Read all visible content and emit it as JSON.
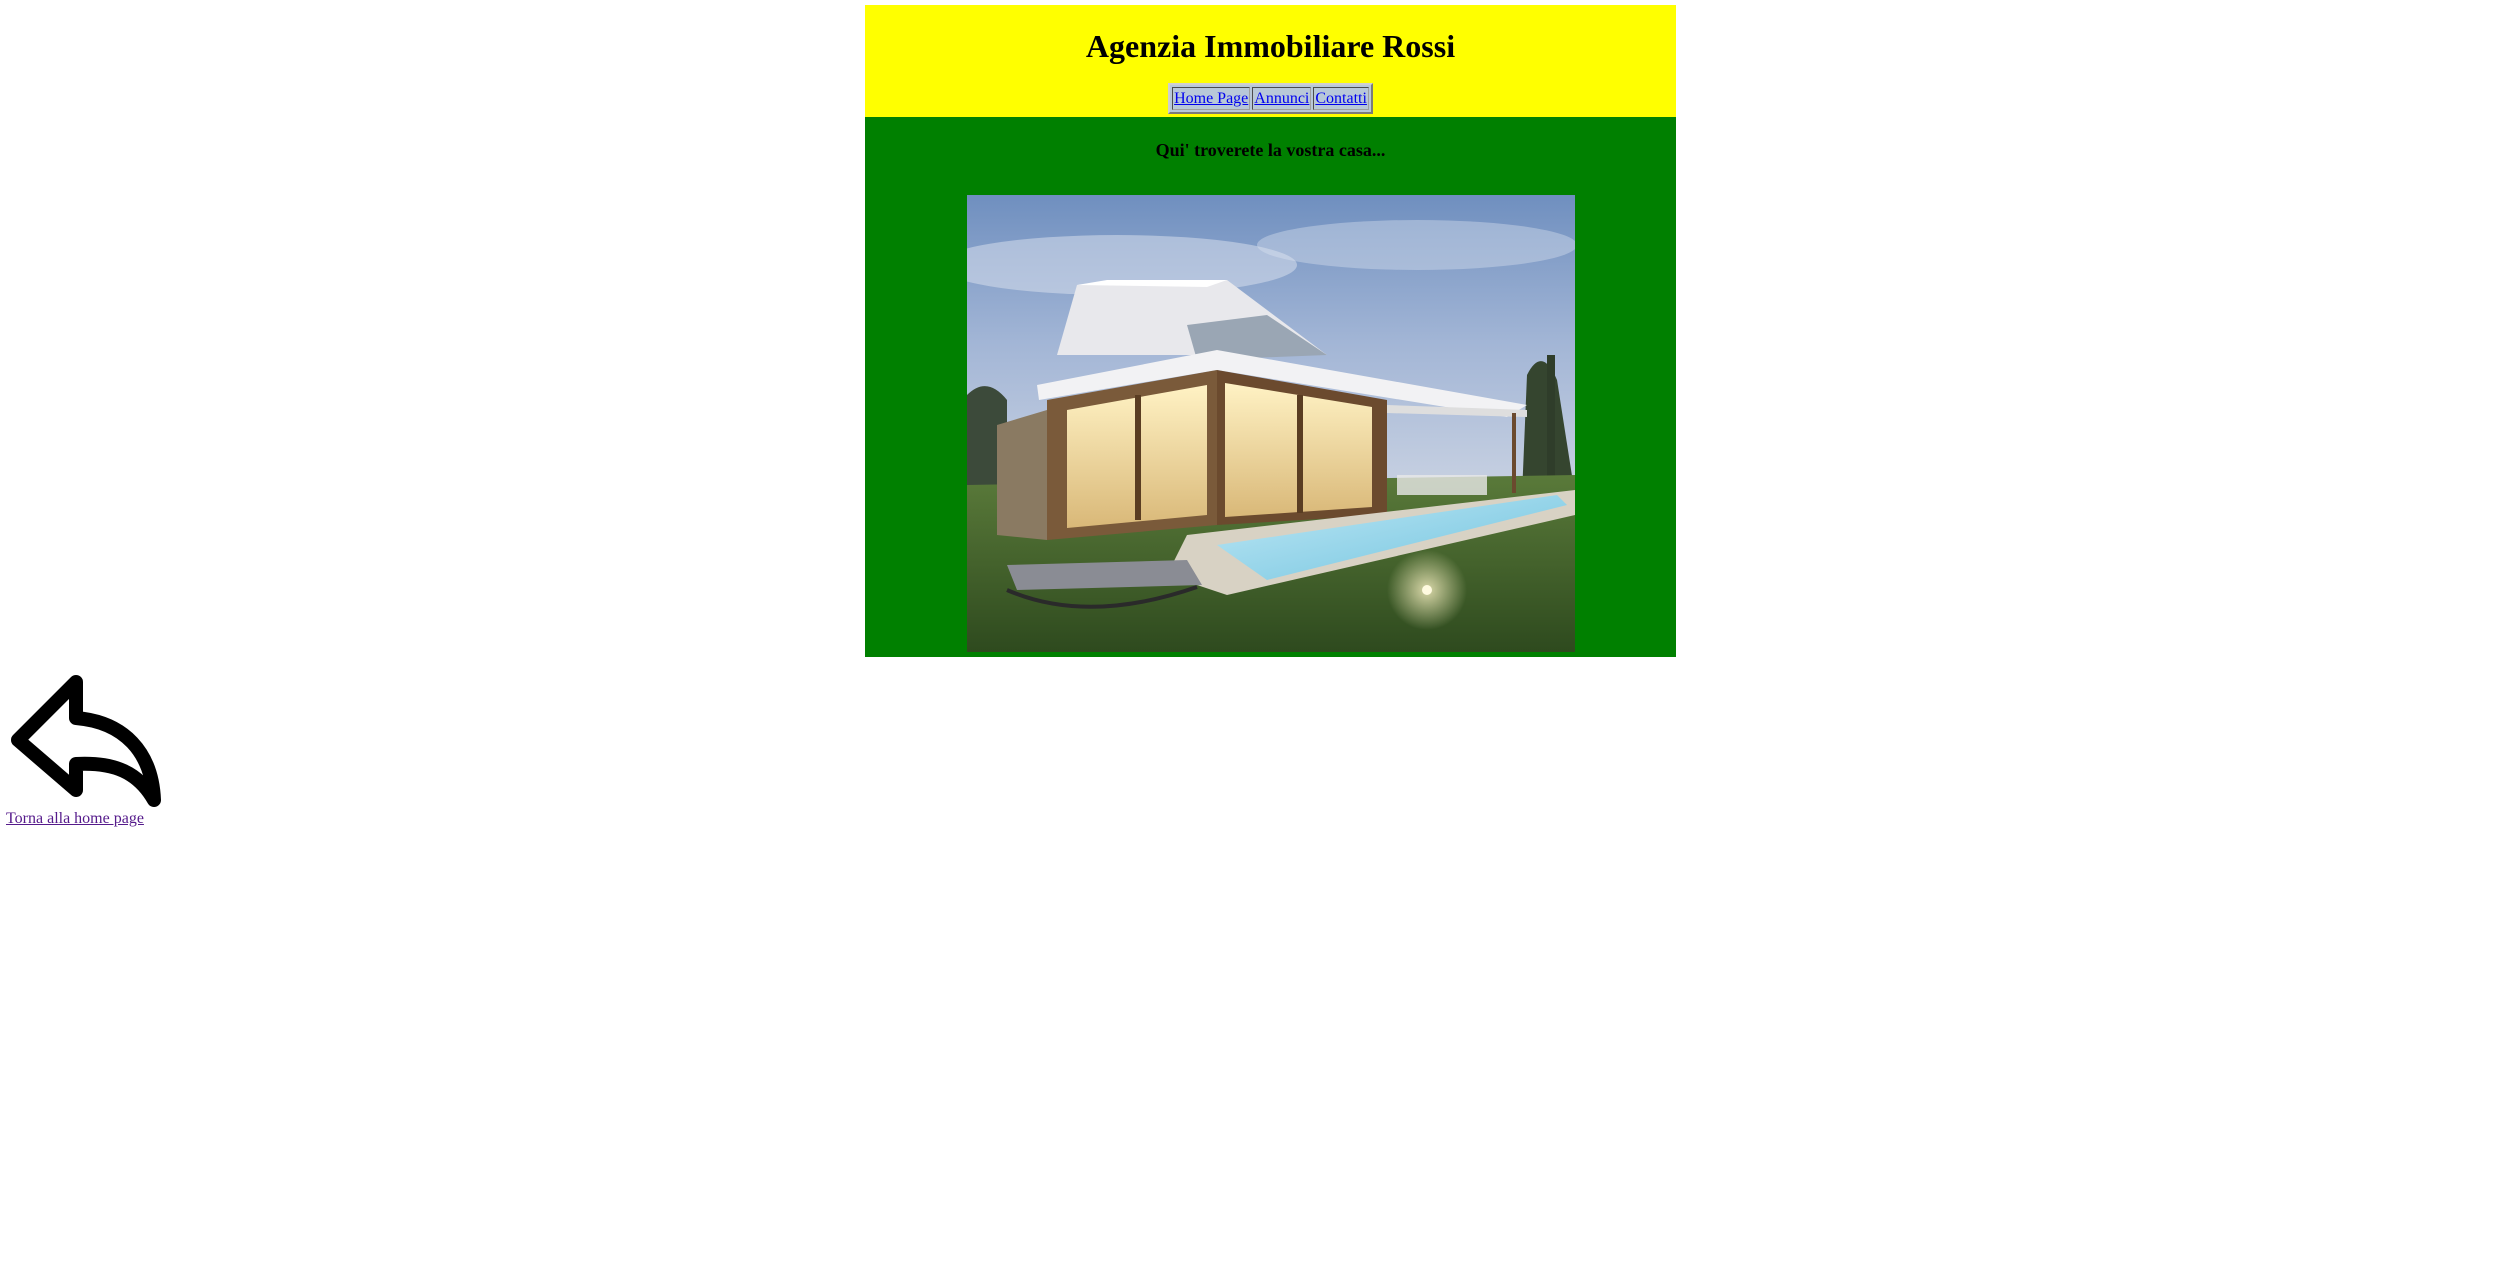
{
  "header": {
    "title": "Agenzia Immobiliare Rossi",
    "background_color": "#ffff00"
  },
  "nav": {
    "items": [
      {
        "label": "Home Page"
      },
      {
        "label": "Annunci"
      },
      {
        "label": "Contatti"
      }
    ]
  },
  "content": {
    "tagline": "Qui' troverete la vostra casa...",
    "background_color": "#008000",
    "image": "house-pool-dusk-photo"
  },
  "back": {
    "icon": "back-arrow-icon",
    "link_label": "Torna alla home page"
  }
}
